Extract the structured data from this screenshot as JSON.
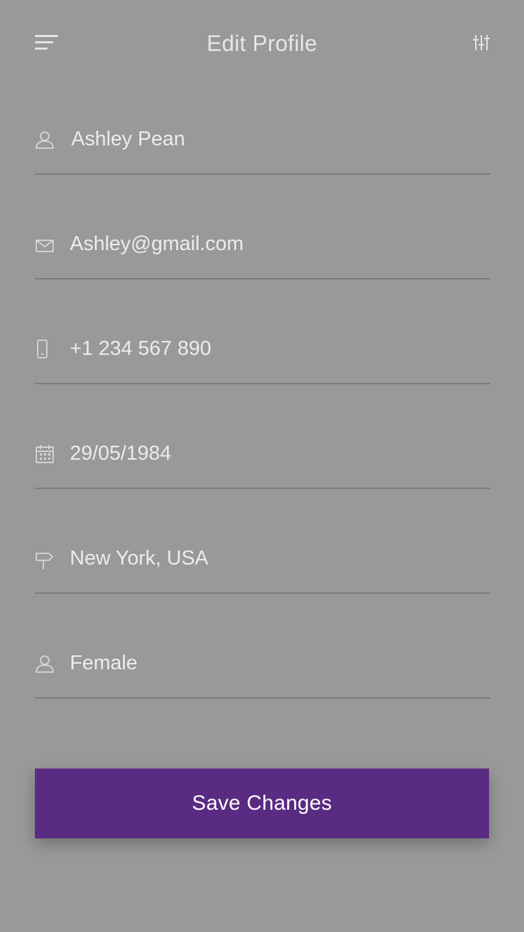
{
  "header": {
    "title": "Edit Profile",
    "menu_icon": "menu-icon",
    "settings_icon": "sliders-icon"
  },
  "fields": [
    {
      "name": "name",
      "icon": "user-icon",
      "value": "Ashley Pean"
    },
    {
      "name": "email",
      "icon": "mail-icon",
      "value": "Ashley@gmail.com"
    },
    {
      "name": "phone",
      "icon": "phone-icon",
      "value": "+1 234 567 890"
    },
    {
      "name": "birthdate",
      "icon": "calendar-icon",
      "value": "29/05/1984"
    },
    {
      "name": "location",
      "icon": "signpost-icon",
      "value": "New York, USA"
    },
    {
      "name": "gender",
      "icon": "user-icon",
      "value": "Female"
    }
  ],
  "actions": {
    "save_label": "Save Changes"
  },
  "colors": {
    "background": "#999999",
    "accent": "#5a2b82",
    "text": "#ececec",
    "divider": "#7b7b7b"
  }
}
